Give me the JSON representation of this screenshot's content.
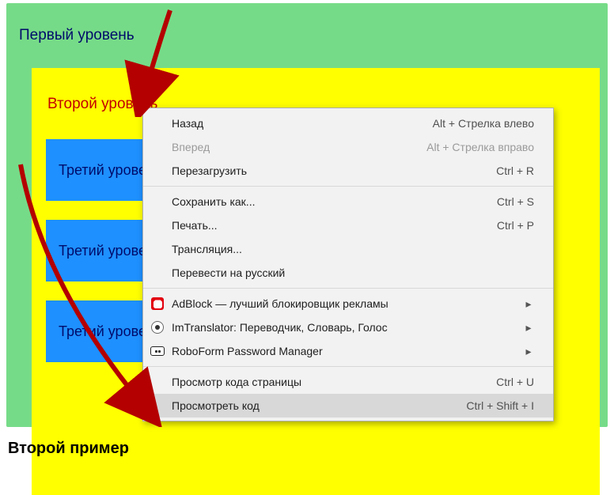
{
  "page": {
    "level1_label": "Первый уровень",
    "level2_label": "Второй уровень",
    "level3_label": "Третий уровень",
    "footer": "Второй пример"
  },
  "context_menu": {
    "groups": [
      [
        {
          "id": "back",
          "label": "Назад",
          "shortcut": "Alt + Стрелка влево",
          "disabled": false,
          "icon": null,
          "submenu": false
        },
        {
          "id": "forward",
          "label": "Вперед",
          "shortcut": "Alt + Стрелка вправо",
          "disabled": true,
          "icon": null,
          "submenu": false
        },
        {
          "id": "reload",
          "label": "Перезагрузить",
          "shortcut": "Ctrl + R",
          "disabled": false,
          "icon": null,
          "submenu": false
        }
      ],
      [
        {
          "id": "saveas",
          "label": "Сохранить как...",
          "shortcut": "Ctrl + S",
          "disabled": false,
          "icon": null,
          "submenu": false
        },
        {
          "id": "print",
          "label": "Печать...",
          "shortcut": "Ctrl + P",
          "disabled": false,
          "icon": null,
          "submenu": false
        },
        {
          "id": "cast",
          "label": "Трансляция...",
          "shortcut": "",
          "disabled": false,
          "icon": null,
          "submenu": false
        },
        {
          "id": "translate",
          "label": "Перевести на русский",
          "shortcut": "",
          "disabled": false,
          "icon": null,
          "submenu": false
        }
      ],
      [
        {
          "id": "adblock",
          "label": "AdBlock — лучший блокировщик рекламы",
          "shortcut": "",
          "disabled": false,
          "icon": "adblock",
          "submenu": true
        },
        {
          "id": "imtrans",
          "label": "ImTranslator: Переводчик, Словарь, Голос",
          "shortcut": "",
          "disabled": false,
          "icon": "imtrans",
          "submenu": true
        },
        {
          "id": "roboform",
          "label": "RoboForm Password Manager",
          "shortcut": "",
          "disabled": false,
          "icon": "robo",
          "submenu": true
        }
      ],
      [
        {
          "id": "viewsrc",
          "label": "Просмотр кода страницы",
          "shortcut": "Ctrl + U",
          "disabled": false,
          "icon": null,
          "submenu": false
        },
        {
          "id": "inspect",
          "label": "Просмотреть код",
          "shortcut": "Ctrl + Shift + I",
          "disabled": false,
          "icon": null,
          "submenu": false,
          "hovered": true
        }
      ]
    ]
  },
  "annotations": {
    "arrow1_target": "level2_label",
    "arrow2_target": "context_menu_inspect"
  }
}
